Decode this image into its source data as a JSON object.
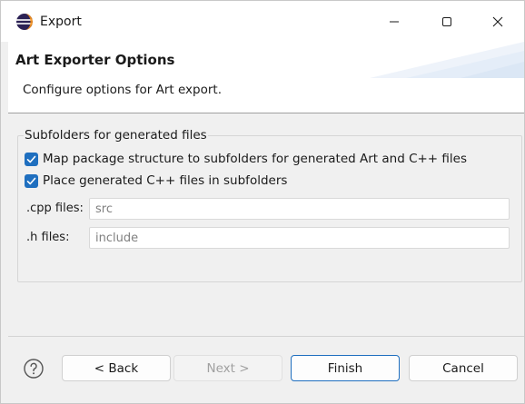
{
  "window": {
    "title": "Export",
    "icon": "eclipse-icon"
  },
  "banner": {
    "title": "Art Exporter Options",
    "description": "Configure options for Art export."
  },
  "group": {
    "label": "Subfolders for generated files",
    "checkboxes": [
      {
        "label": "Map package structure to subfolders for generated Art and C++ files",
        "checked": true
      },
      {
        "label": "Place generated C++ files in subfolders",
        "checked": true
      }
    ],
    "fields": [
      {
        "label": ".cpp files:",
        "value": "src"
      },
      {
        "label": ".h files:",
        "value": "include"
      }
    ]
  },
  "footer": {
    "help_icon": "help-icon",
    "back_label": "< Back",
    "next_label": "Next >",
    "finish_label": "Finish",
    "cancel_label": "Cancel"
  },
  "colors": {
    "accent": "#1f6fbf",
    "background": "#f0f0f0"
  }
}
